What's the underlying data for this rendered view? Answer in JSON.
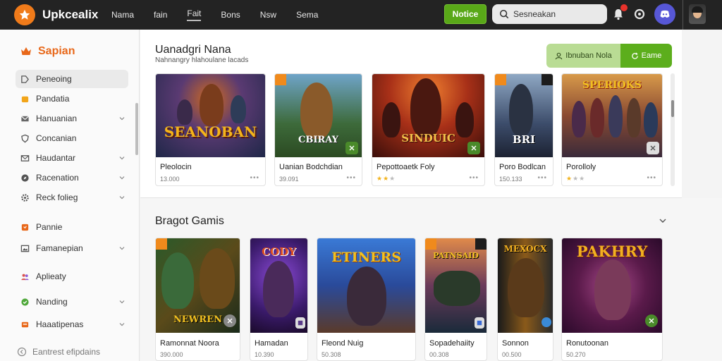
{
  "header": {
    "brand": "Upkcealix",
    "nav": [
      "Nama",
      "fain",
      "Fait",
      "Bons",
      "Nsw",
      "Sema"
    ],
    "notice_label": "Notice",
    "search_value": "Sesneakan"
  },
  "sidebar": {
    "title": "Sapian",
    "items": [
      {
        "label": "Peneoing",
        "icon": "tag-icon",
        "active": true,
        "chevron": false
      },
      {
        "label": "Pandatia",
        "icon": "puzzle-icon",
        "chevron": false
      },
      {
        "label": "Hanuanian",
        "icon": "mail-icon",
        "chevron": true
      },
      {
        "label": "Concanian",
        "icon": "shield-icon",
        "chevron": false
      },
      {
        "label": "Haudantar",
        "icon": "envelope-icon",
        "chevron": true
      },
      {
        "label": "Racenation",
        "icon": "compass-icon",
        "chevron": true
      },
      {
        "label": "Reck folieg",
        "icon": "gear-icon",
        "chevron": true
      },
      {
        "label": "Pannie",
        "icon": "bag-icon",
        "chevron": false
      },
      {
        "label": "Famanepian",
        "icon": "image-icon",
        "chevron": true
      },
      {
        "label": "Aplieaty",
        "icon": "people-icon",
        "chevron": false
      },
      {
        "label": "Nanding",
        "icon": "circle-check-icon",
        "chevron": true
      },
      {
        "label": "Haaatipenas",
        "icon": "box-icon",
        "chevron": true
      }
    ],
    "footer": "Eantrest efipdains"
  },
  "featured": {
    "title": "Uanadgri Nana",
    "subtitle": "Nahnangry hlahoulane lacads",
    "btn_left": "Ibnuban Nola",
    "btn_right": "Eame",
    "cards": [
      {
        "name": "Pleolocin",
        "meta": "13.000",
        "art_title": "SEANOBAN",
        "rating": null
      },
      {
        "name": "Uanian Bodchdian",
        "meta": "39.091",
        "art_title": "CBIRAY",
        "rating": null
      },
      {
        "name": "Pepottoaetk Foly",
        "meta": "",
        "art_title": "SINDUIC",
        "rating": 2
      },
      {
        "name": "Poro Bodlcan",
        "meta": "150.133",
        "art_title": "BRI",
        "rating": null
      },
      {
        "name": "Porolloly",
        "meta": "",
        "art_title": "SPERIOKS",
        "rating": 1
      }
    ]
  },
  "games": {
    "title": "Bragot Gamis",
    "cards": [
      {
        "name": "Ramonnat Noora",
        "meta": "390.000",
        "art_title": "NEWREN"
      },
      {
        "name": "Hamadan",
        "meta": "10.390",
        "art_title": "CODY"
      },
      {
        "name": "Fleond Nuig",
        "meta": "50.308",
        "art_title": "ETINERS"
      },
      {
        "name": "Sopadehaiity",
        "meta": "00.308",
        "art_title": "PATNSAID"
      },
      {
        "name": "Sonnon",
        "meta": "00.500",
        "art_title": "MEXOCX"
      },
      {
        "name": "Ronutoonan",
        "meta": "50.270",
        "art_title": "PAKHRY"
      }
    ]
  },
  "colors": {
    "accent": "#e8681a",
    "green": "#5cae1c",
    "topbar": "#232323"
  }
}
